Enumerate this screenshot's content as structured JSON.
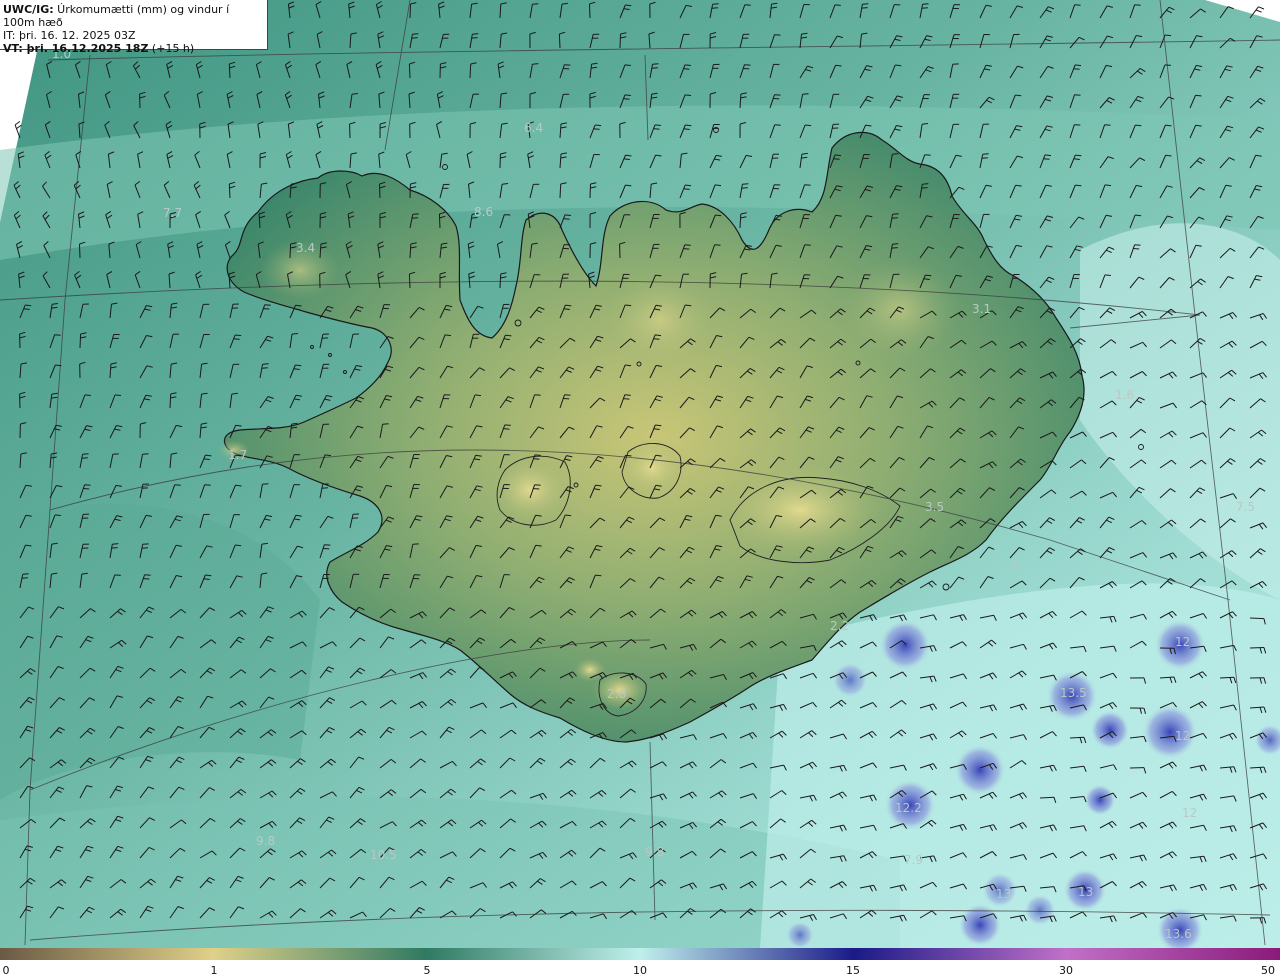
{
  "header": {
    "product_prefix": "UWC/IG:",
    "product_title": " Úrkomumætti (mm) og vindur í 100m hæð",
    "issue_time": "IT: þri. 16. 12. 2025 03Z",
    "valid_prefix": "VT: þri. 16.12.2025 18Z",
    "valid_offset": " (+15 h)"
  },
  "map_labels": [
    {
      "id": "lbl-1",
      "text": "1.0"
    },
    {
      "id": "lbl-2",
      "text": "6.4"
    },
    {
      "id": "lbl-3",
      "text": "7.7"
    },
    {
      "id": "lbl-4",
      "text": "8.6"
    },
    {
      "id": "lbl-5",
      "text": "3.4"
    },
    {
      "id": "lbl-6",
      "text": "3.1"
    },
    {
      "id": "lbl-7",
      "text": "1.6"
    },
    {
      "id": "lbl-8",
      "text": "1.7"
    },
    {
      "id": "lbl-9",
      "text": "3.5"
    },
    {
      "id": "lbl-10",
      "text": "7.5"
    },
    {
      "id": "lbl-11",
      "text": "9"
    },
    {
      "id": "lbl-12",
      "text": "2.2"
    },
    {
      "id": "lbl-13",
      "text": "2.8"
    },
    {
      "id": "lbl-14",
      "text": "12"
    },
    {
      "id": "lbl-15",
      "text": "13.5"
    },
    {
      "id": "lbl-16",
      "text": "12"
    },
    {
      "id": "lbl-17",
      "text": "12.2"
    },
    {
      "id": "lbl-18",
      "text": "7.9"
    },
    {
      "id": "lbl-19",
      "text": "9.8"
    },
    {
      "id": "lbl-20",
      "text": "10.5"
    },
    {
      "id": "lbl-21",
      "text": "9.8"
    },
    {
      "id": "lbl-22",
      "text": "13"
    },
    {
      "id": "lbl-23",
      "text": "13.6"
    },
    {
      "id": "lbl-24",
      "text": "12"
    },
    {
      "id": "lbl-25",
      "text": "13"
    }
  ],
  "colorbar": {
    "ticks": [
      {
        "value": "0"
      },
      {
        "value": "1"
      },
      {
        "value": "5"
      },
      {
        "value": "10"
      },
      {
        "value": "15"
      },
      {
        "value": "30"
      },
      {
        "value": "50"
      }
    ],
    "colors": {
      "c0": "#6b5a44",
      "c1": "#e0d088",
      "c5": "#2f7a62",
      "c10": "#bff0ec",
      "c15": "#1a1a88",
      "c30": "#c070c8",
      "c50": "#8a1a7a"
    }
  },
  "legend": {
    "wind_symbol": "wind-barb-icon",
    "accent_sea": "#9fd8cf",
    "accent_land": "#3e8b6f",
    "accent_high": "#c8c870",
    "accent_heavy": "#5a62c8"
  }
}
